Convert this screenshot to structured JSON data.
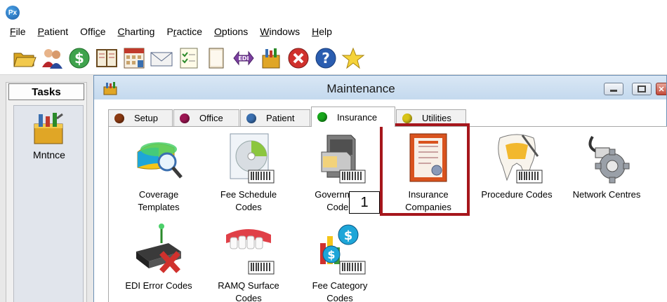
{
  "app": {
    "logo_text": "Px"
  },
  "menu": [
    {
      "pre": "",
      "u": "F",
      "post": "ile"
    },
    {
      "pre": "",
      "u": "P",
      "post": "atient"
    },
    {
      "pre": "Offi",
      "u": "c",
      "post": "e"
    },
    {
      "pre": "",
      "u": "C",
      "post": "harting"
    },
    {
      "pre": "P",
      "u": "r",
      "post": "actice"
    },
    {
      "pre": "",
      "u": "O",
      "post": "ptions"
    },
    {
      "pre": "",
      "u": "W",
      "post": "indows"
    },
    {
      "pre": "",
      "u": "H",
      "post": "elp"
    }
  ],
  "toolbar": [
    "folder-open-icon",
    "patients-icon",
    "money-icon",
    "ledger-book-icon",
    "calendar-chart-icon",
    "envelope-icon",
    "checklist-icon",
    "document-icon",
    "edi-icon",
    "maintenance-icon",
    "stop-icon",
    "help-icon",
    "favorites-star-icon"
  ],
  "tasks": {
    "header": "Tasks",
    "item_label": "Mntnce"
  },
  "window": {
    "title": "Maintenance"
  },
  "tabs": [
    {
      "label": "Setup",
      "color": "#8b3a12"
    },
    {
      "label": "Office",
      "color": "#9b1552"
    },
    {
      "label": "Patient",
      "color": "#3a6fb0"
    },
    {
      "label": "Insurance",
      "color": "#18a81c",
      "active": true
    },
    {
      "label": "Utilities",
      "color": "#d8c418"
    }
  ],
  "items": [
    {
      "label": "Coverage\nTemplates",
      "icon": "coverage-templates-icon"
    },
    {
      "label": "Fee Schedule\nCodes",
      "icon": "fee-schedule-codes-icon"
    },
    {
      "label": "Government\nCodes",
      "icon": "government-codes-icon"
    },
    {
      "label": "Insurance\nCompanies",
      "icon": "insurance-companies-icon"
    },
    {
      "label": "Procedure Codes",
      "icon": "procedure-codes-icon"
    },
    {
      "label": "Network Centres",
      "icon": "network-centres-icon"
    },
    {
      "label": "EDI Error Codes",
      "icon": "edi-error-codes-icon"
    },
    {
      "label": "RAMQ Surface\nCodes",
      "icon": "ramq-surface-codes-icon"
    },
    {
      "label": "Fee Category\nCodes",
      "icon": "fee-category-codes-icon"
    }
  ],
  "annotation": {
    "callout_number": "1",
    "highlight_color": "#a6161c"
  }
}
